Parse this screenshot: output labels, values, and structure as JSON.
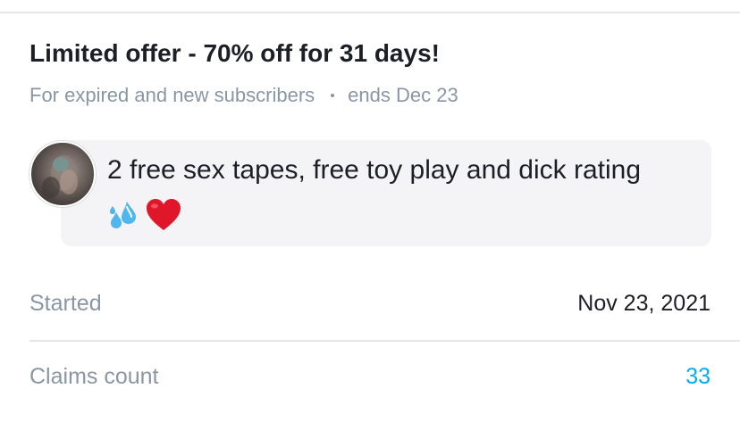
{
  "offer": {
    "title": "Limited offer - 70% off for 31 days!",
    "audience": "For expired and new subscribers",
    "ends": "ends Dec 23"
  },
  "message": {
    "text": "2 free sex tapes, free toy play and dick rating",
    "emojis": [
      "sweat-droplets-emoji",
      "red-heart-emoji"
    ]
  },
  "details": {
    "started_label": "Started",
    "started_value": "Nov 23, 2021",
    "claims_label": "Claims count",
    "claims_value": "33"
  },
  "colors": {
    "accent": "#00aff0",
    "muted_text": "#8a96a3",
    "primary_text": "#1d1f26",
    "bubble_bg": "#f4f4f6",
    "heart": "#e0162b",
    "droplets": "#4fb6ee"
  }
}
